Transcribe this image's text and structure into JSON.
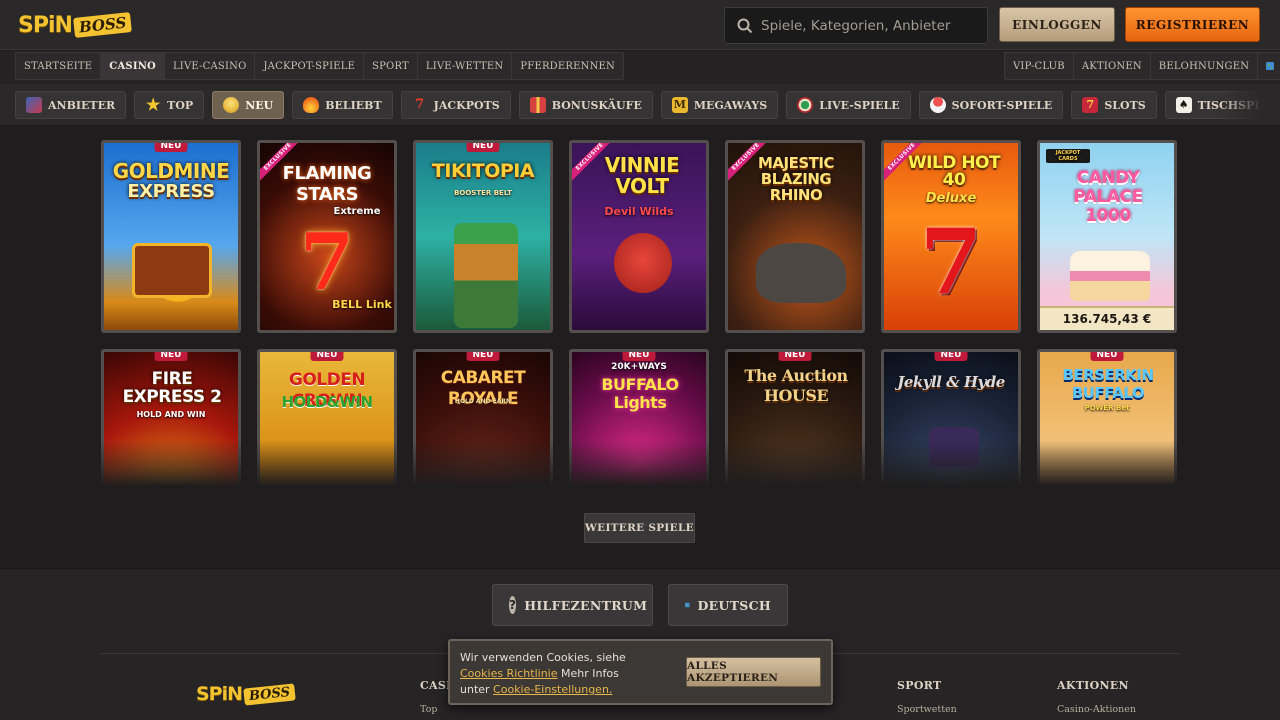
{
  "header": {
    "logo_spin": "SPiN",
    "logo_boss": "BOSS",
    "search_placeholder": "Spiele, Kategorien, Anbieter",
    "login_label": "EINLOGGEN",
    "register_label": "REGISTRIEREN"
  },
  "mainnav": {
    "left": [
      "STARTSEITE",
      "CASINO",
      "LIVE-CASINO",
      "JACKPOT-SPIELE",
      "SPORT",
      "LIVE-WETTEN",
      "PFERDERENNEN"
    ],
    "right": [
      "VIP-CLUB",
      "AKTIONEN",
      "BELOHNUNGEN"
    ],
    "active": "CASINO"
  },
  "categories": [
    {
      "label": "ANBIETER",
      "icon": "provider-icon"
    },
    {
      "label": "TOP",
      "icon": "star-icon"
    },
    {
      "label": "NEU",
      "icon": "bulb-icon"
    },
    {
      "label": "BELIEBT",
      "icon": "fire-icon"
    },
    {
      "label": "JACKPOTS",
      "icon": "seven-icon"
    },
    {
      "label": "BONUSKÄUFE",
      "icon": "gift-icon"
    },
    {
      "label": "MEGAWAYS",
      "icon": "megaways-icon"
    },
    {
      "label": "LIVE-SPIELE",
      "icon": "roulette-icon"
    },
    {
      "label": "SOFORT-SPIELE",
      "icon": "instant-icon"
    },
    {
      "label": "SLOTS",
      "icon": "slot-icon"
    },
    {
      "label": "TISCHSPIELE",
      "icon": "cards-icon"
    }
  ],
  "games": [
    {
      "title": "GOLDMINE",
      "subtitle": "EXPRESS",
      "badge": "NEU"
    },
    {
      "title": "FLAMING STARS",
      "subtitle": "Extreme",
      "badge": "EXCLUSIVE",
      "footer_text": "BELL Link"
    },
    {
      "title": "TIKITOPIA",
      "subtitle": "BOOSTER BELT",
      "badge": "NEU"
    },
    {
      "title": "VINNIE VOLT",
      "subtitle": "Devil Wilds",
      "badge": "EXCLUSIVE"
    },
    {
      "title": "MAJESTIC BLAZING RHINO",
      "subtitle": "",
      "badge": "EXCLUSIVE"
    },
    {
      "title": "WILD HOT 40",
      "subtitle": "Deluxe",
      "badge": "EXCLUSIVE"
    },
    {
      "title": "CANDY PALACE 1000",
      "subtitle": "",
      "badge": "",
      "top_label": "JACKPOT CARDS",
      "jackpot": "136.745,43 €"
    },
    {
      "title": "FIRE EXPRESS 2",
      "subtitle": "HOLD AND WIN",
      "badge": "NEU"
    },
    {
      "title": "GOLDEN CROWN",
      "subtitle": "HOLD&WIN",
      "badge": "NEU"
    },
    {
      "title": "CABARET ROYALE",
      "subtitle": "HOLD AND EARN",
      "badge": "NEU"
    },
    {
      "title": "BUFFALO Lights",
      "subtitle": "20K+WAYS",
      "badge": "NEU"
    },
    {
      "title": "The Auction HOUSE",
      "subtitle": "",
      "badge": "NEU"
    },
    {
      "title": "Jekyll & Hyde",
      "subtitle": "",
      "badge": "NEU"
    },
    {
      "title": "BERSERKIN BUFFALO",
      "subtitle": "POWER Bet",
      "badge": "NEU"
    }
  ],
  "more_label": "WEITERE SPIELE",
  "footer": {
    "help_label": "HILFEZENTRUM",
    "language_label": "DEUTSCH",
    "col_casino_heading": "CASI",
    "col_casino_link": "Top",
    "col_sport_heading": "SPORT",
    "col_sport_link": "Sportwetten",
    "col_promo_heading": "AKTIONEN",
    "col_promo_link": "Casino-Aktionen"
  },
  "cookie": {
    "text_1": "Wir verwenden Cookies, siehe",
    "link_1": "Cookies Richtlinie",
    "text_2": "Mehr Infos",
    "text_3": "unter",
    "link_2": "Cookie-Einstellungen.",
    "accept_label": "ALLES AKZEPTIEREN"
  }
}
